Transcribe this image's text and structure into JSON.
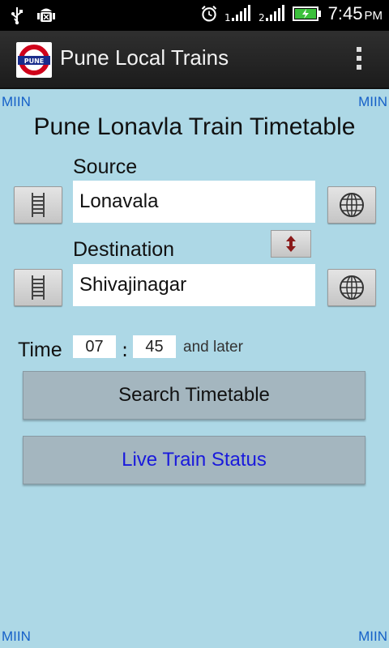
{
  "statusbar": {
    "time": "7:45",
    "ampm": "PM",
    "icons": [
      "usb-icon",
      "android-debug-icon",
      "alarm-icon",
      "signal-icon",
      "signal-2-icon",
      "battery-charging-icon"
    ]
  },
  "actionbar": {
    "title": "Pune Local Trains",
    "logo_text": "PUNE"
  },
  "corner_label": "MIIN",
  "page_title": "Pune Lonavla Train Timetable",
  "source": {
    "label": "Source",
    "value": "Lonavala"
  },
  "destination": {
    "label": "Destination",
    "value": "Shivajinagar"
  },
  "time": {
    "label": "Time",
    "hour": "07",
    "separator": ":",
    "minute": "45",
    "suffix": "and later"
  },
  "buttons": {
    "search": "Search Timetable",
    "live": "Live Train Status"
  },
  "colors": {
    "background": "#add8e6",
    "live_text": "#1a1adc",
    "button": "#a4b6bf"
  }
}
